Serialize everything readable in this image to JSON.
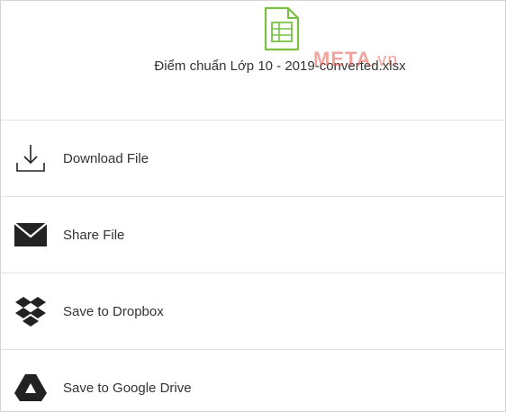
{
  "file": {
    "name": "Điểm chuẩn Lớp 10 - 2019-converted.xlsx",
    "icon": "spreadsheet-file-icon",
    "icon_color": "#7ac143"
  },
  "watermark": {
    "brand": "META",
    "suffix": ".vn",
    "color": "#e85a4f"
  },
  "menu": {
    "items": [
      {
        "label": "Download File",
        "icon": "download-icon"
      },
      {
        "label": "Share File",
        "icon": "envelope-icon"
      },
      {
        "label": "Save to Dropbox",
        "icon": "dropbox-icon"
      },
      {
        "label": "Save to Google Drive",
        "icon": "google-drive-icon"
      }
    ]
  }
}
